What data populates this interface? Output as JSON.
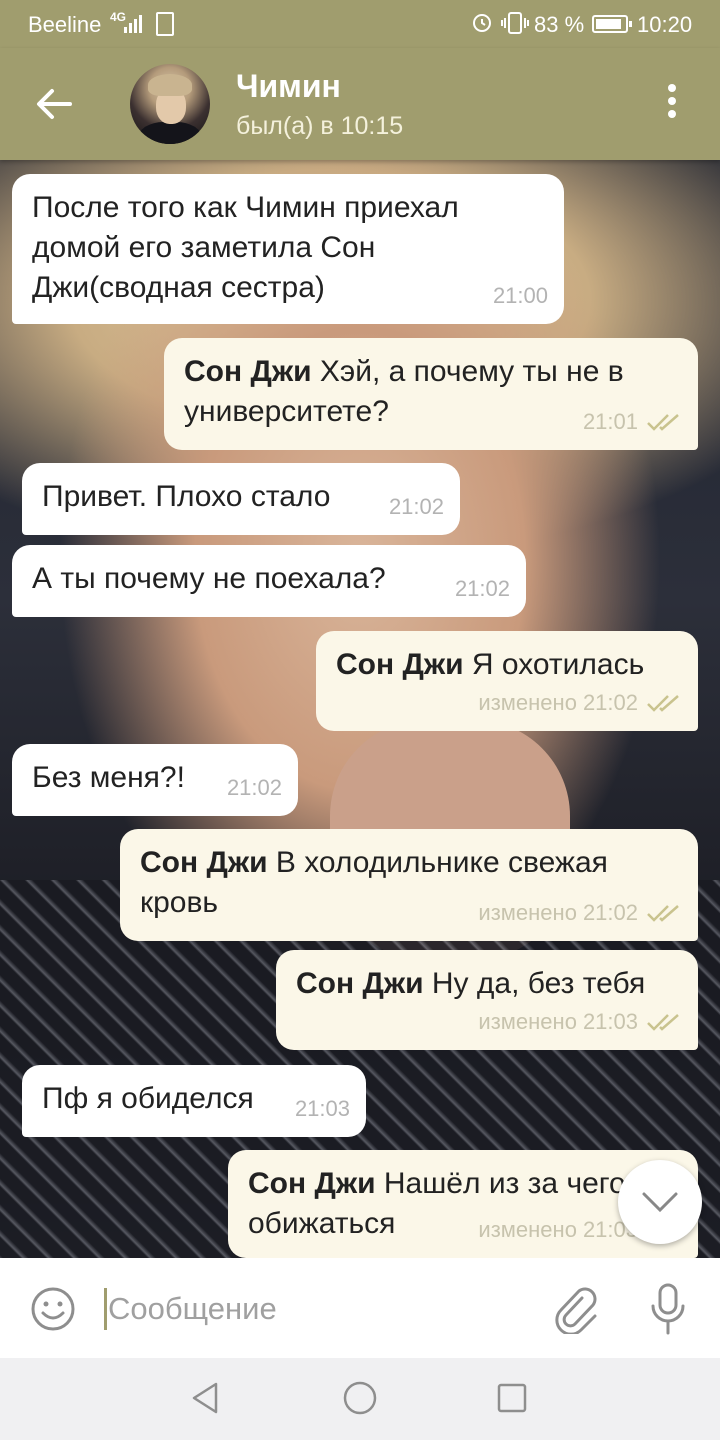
{
  "status_bar": {
    "carrier": "Beeline",
    "network": "4G",
    "battery_percent": "83 %",
    "battery_level": 0.83,
    "time": "10:20"
  },
  "header": {
    "contact_name": "Чимин",
    "last_seen": "был(а) в 10:15"
  },
  "messages": [
    {
      "direction": "in",
      "sender": "",
      "text": "После того как Чимин приехал домой его заметила Сон Джи(сводная сестра)",
      "edited": "",
      "time": "21:00"
    },
    {
      "direction": "out",
      "sender": "Сон Джи",
      "text": "Хэй, а почему ты не в университете?",
      "edited": "",
      "time": "21:01"
    },
    {
      "direction": "in",
      "sender": "",
      "text": "Привет. Плохо стало",
      "edited": "",
      "time": "21:02"
    },
    {
      "direction": "in",
      "sender": "",
      "text": "А ты почему не поехала?",
      "edited": "",
      "time": "21:02"
    },
    {
      "direction": "out",
      "sender": "Сон Джи",
      "text": "Я охотилась",
      "edited": "изменено",
      "time": "21:02"
    },
    {
      "direction": "in",
      "sender": "",
      "text": "Без меня?!",
      "edited": "",
      "time": "21:02"
    },
    {
      "direction": "out",
      "sender": "Сон Джи",
      "text": "В холодильнике свежая кровь",
      "edited": "изменено",
      "time": "21:02"
    },
    {
      "direction": "out",
      "sender": "Сон Джи",
      "text": "Ну да, без тебя",
      "edited": "изменено",
      "time": "21:03"
    },
    {
      "direction": "in",
      "sender": "",
      "text": "Пф я обиделся",
      "edited": "",
      "time": "21:03"
    },
    {
      "direction": "out",
      "sender": "Сон Джи",
      "text": "Нашёл из за чего обижаться",
      "edited": "изменено",
      "time": "21:03"
    }
  ],
  "input": {
    "placeholder": "Сообщение",
    "value": ""
  },
  "icons": {
    "back": "arrow-left-icon",
    "menu": "more-vert-icon",
    "emoji": "smiley-icon",
    "attach": "paperclip-icon",
    "mic": "microphone-icon",
    "scroll_down": "chevron-down-icon",
    "read_receipt": "double-check-icon"
  },
  "colors": {
    "header": "#a09d6e",
    "outgoing_bubble": "#fbf7e8",
    "incoming_bubble": "#ffffff",
    "checks": "#c9c38e"
  }
}
